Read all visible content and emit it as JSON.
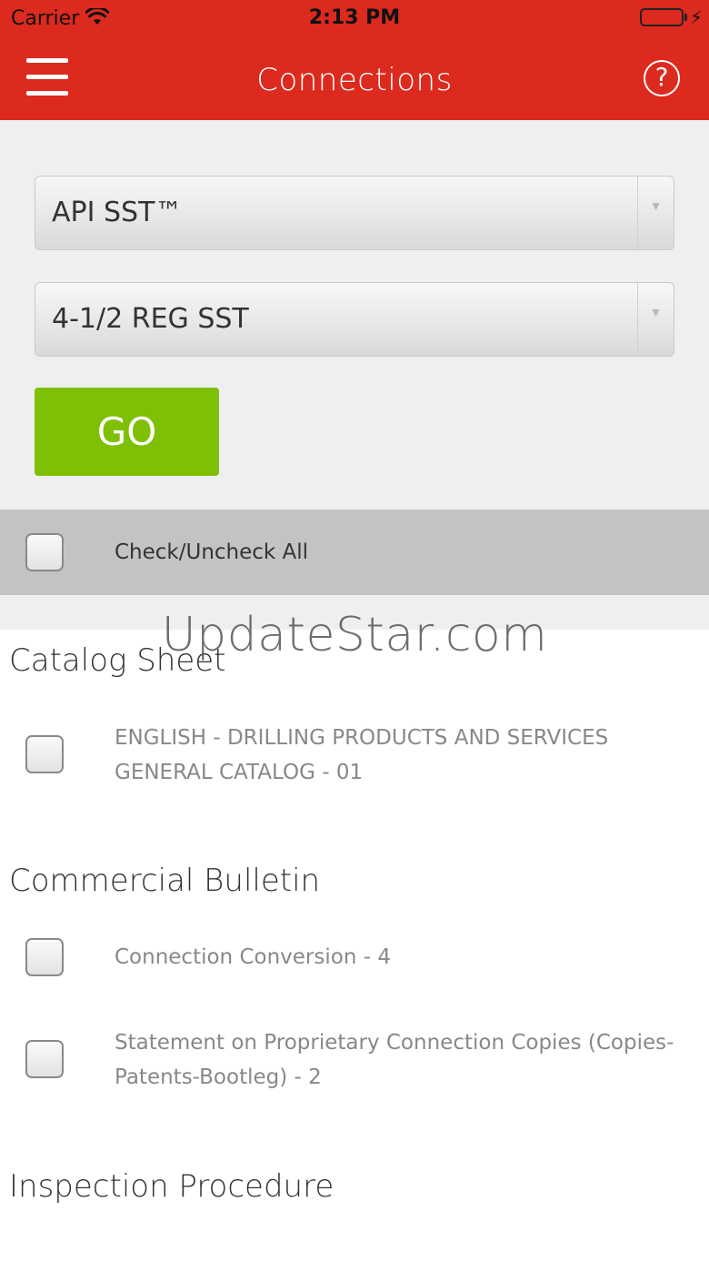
{
  "status_bar": {
    "carrier": "Carrier",
    "time": "2:13 PM",
    "battery_level": 1.0,
    "wifi_icon": "wifi-icon",
    "charging_icon": "bolt-icon"
  },
  "nav": {
    "title": "Connections",
    "menu_icon": "hamburger-menu-icon",
    "help_glyph": "?"
  },
  "filters": {
    "connection_type": "API SST™",
    "connection_size": "4-1/2 REG SST",
    "go_label": "GO"
  },
  "check_all": {
    "label": "Check/Uncheck All",
    "checked": false
  },
  "watermark": "UpdateStar.com",
  "sections": [
    {
      "title": "Catalog Sheet",
      "items": [
        {
          "label": "ENGLISH - DRILLING PRODUCTS AND SERVICES GENERAL CATALOG - 01",
          "checked": false
        }
      ]
    },
    {
      "title": "Commercial Bulletin",
      "items": [
        {
          "label": "Connection Conversion - 4",
          "checked": false
        },
        {
          "label": "Statement on Proprietary Connection Copies (Copies-Patents-Bootleg) - 2",
          "checked": false
        }
      ]
    },
    {
      "title": "Inspection Procedure",
      "items": []
    }
  ],
  "colors": {
    "brand_red": "#dc2a1e",
    "go_green": "#7fbf06",
    "panel_gray": "#eeeff0",
    "bar_gray": "#c3c3c3"
  }
}
